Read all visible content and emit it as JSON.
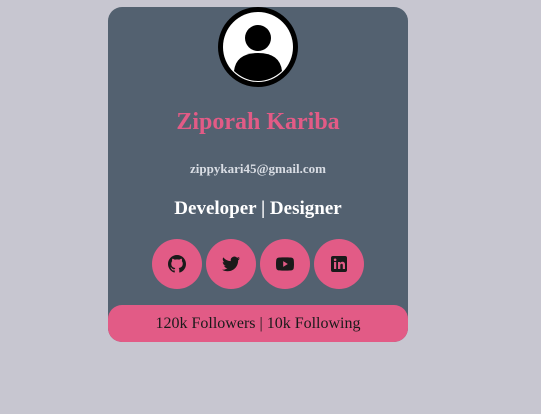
{
  "profile": {
    "name": "Ziporah Kariba",
    "email": "zippykari45@gmail.com",
    "role": "Developer | Designer",
    "stats": "120k Followers | 10k Following"
  },
  "socials": [
    {
      "icon": "github-icon"
    },
    {
      "icon": "twitter-icon"
    },
    {
      "icon": "youtube-icon"
    },
    {
      "icon": "linkedin-icon"
    }
  ],
  "colors": {
    "background": "#c7c6d0",
    "card": "#536170",
    "accent": "#e25b86",
    "name": "#e25b86",
    "email": "#d9dde4",
    "role": "#ffffff"
  }
}
